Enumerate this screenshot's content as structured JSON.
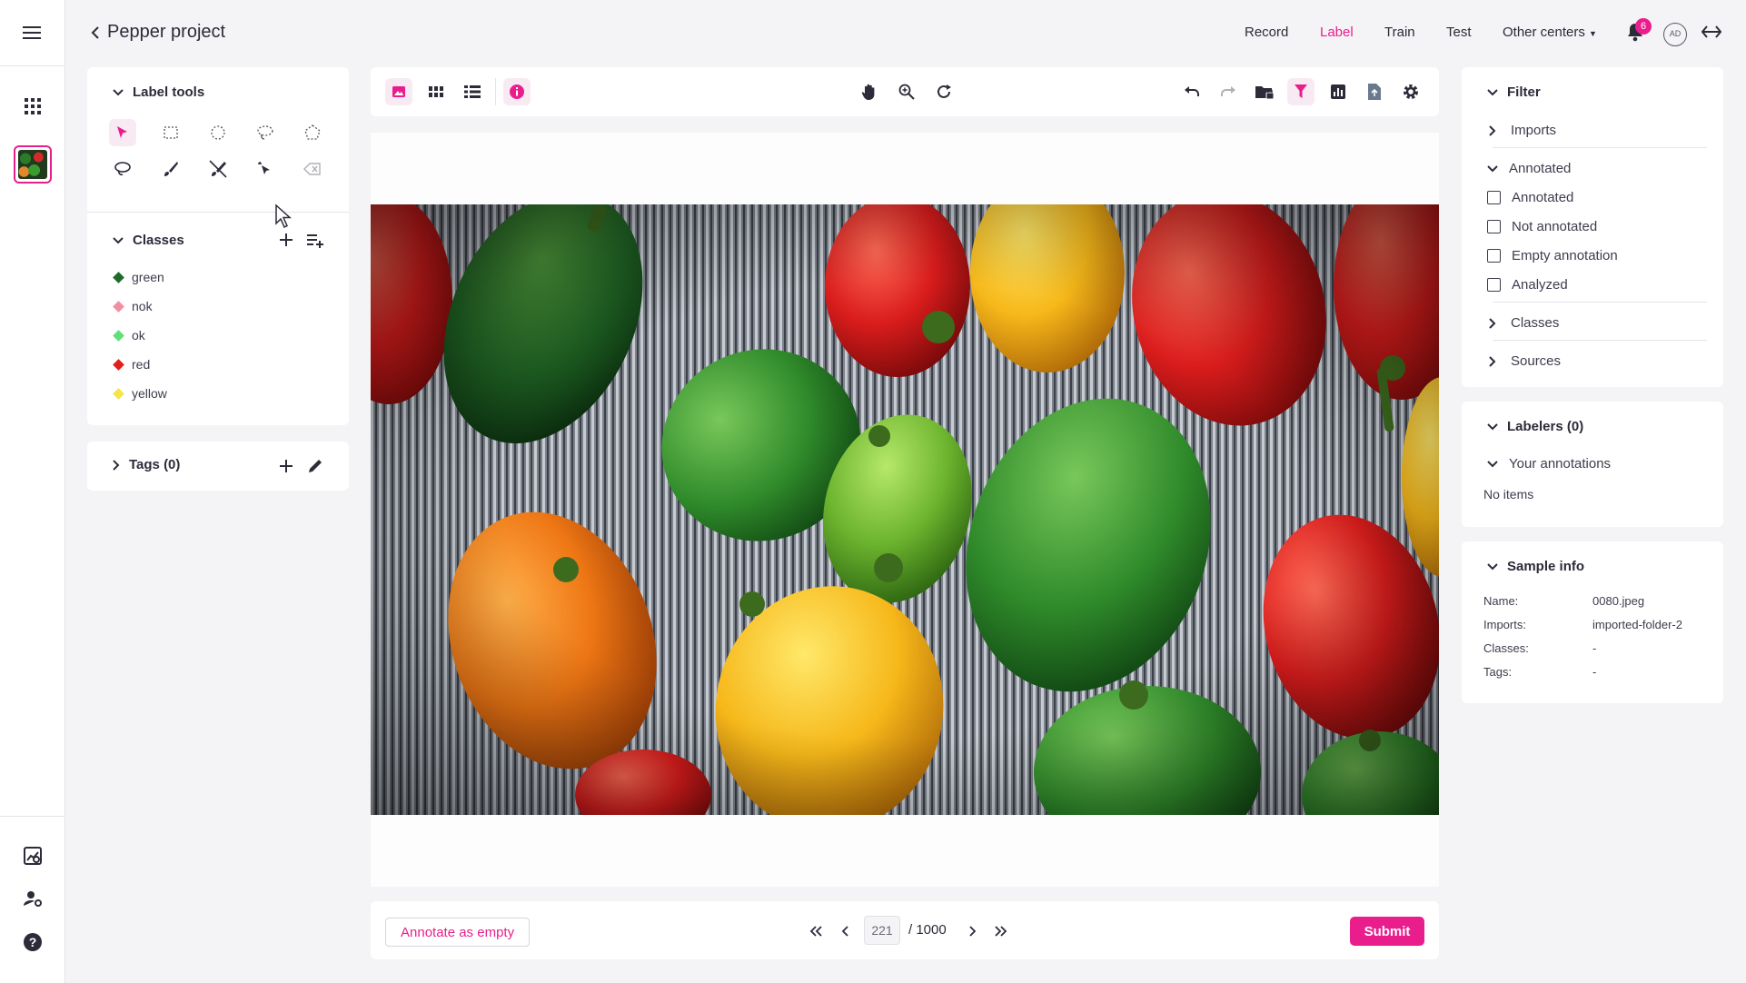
{
  "colors": {
    "accent": "#e91e8c",
    "text": "#2b2b3a",
    "panel_bg": "#ffffff",
    "page_bg": "#f4f4f6"
  },
  "header": {
    "project_title": "Pepper project",
    "nav": [
      {
        "label": "Record",
        "active": false
      },
      {
        "label": "Label",
        "active": true
      },
      {
        "label": "Train",
        "active": false
      },
      {
        "label": "Test",
        "active": false
      },
      {
        "label": "Other centers",
        "active": false
      }
    ],
    "notifications_count": "6",
    "avatar_initials": "AD"
  },
  "left_panel": {
    "label_tools": {
      "title": "Label tools",
      "tools": [
        "pointer-icon",
        "rectangle-icon",
        "ellipse-icon",
        "lasso-icon",
        "polygon-icon",
        "freehand-lasso-icon",
        "brush-icon",
        "eraser-brush-icon",
        "magic-select-icon",
        "smart-eraser-icon"
      ]
    },
    "classes": {
      "title": "Classes",
      "items": [
        {
          "label": "green",
          "color": "#1e6b2c"
        },
        {
          "label": "nok",
          "color": "#f08fa0"
        },
        {
          "label": "ok",
          "color": "#5fe07a"
        },
        {
          "label": "red",
          "color": "#e0201c"
        },
        {
          "label": "yellow",
          "color": "#f5e44a"
        }
      ]
    },
    "tags": {
      "title": "Tags (0)"
    }
  },
  "toolbar": {
    "left": [
      "image-view-icon",
      "grid-view-icon",
      "list-view-icon",
      "info-icon"
    ],
    "center": [
      "pan-hand-icon",
      "zoom-icon",
      "rotate-icon"
    ],
    "right": [
      "undo-icon",
      "redo-icon",
      "folder-lock-icon",
      "filter-icon",
      "chart-icon",
      "export-icon",
      "settings-icon"
    ]
  },
  "pagination": {
    "current": "221",
    "total": "/ 1000"
  },
  "bottom": {
    "annotate_empty_label": "Annotate as empty",
    "submit_label": "Submit"
  },
  "filter_panel": {
    "title": "Filter",
    "imports_label": "Imports",
    "annotated_section": "Annotated",
    "options": [
      {
        "label": "Annotated",
        "checked": false
      },
      {
        "label": "Not annotated",
        "checked": false
      },
      {
        "label": "Empty annotation",
        "checked": false
      },
      {
        "label": "Analyzed",
        "checked": false
      }
    ],
    "classes_label": "Classes",
    "sources_label": "Sources"
  },
  "labelers_panel": {
    "title": "Labelers (0)",
    "your_annotations_label": "Your annotations",
    "empty_text": "No items"
  },
  "sample_info": {
    "title": "Sample info",
    "rows": [
      {
        "key": "Name:",
        "value": "0080.jpeg"
      },
      {
        "key": "Imports:",
        "value": "imported-folder-2"
      },
      {
        "key": "Classes:",
        "value": "-"
      },
      {
        "key": "Tags:",
        "value": "-"
      }
    ]
  }
}
